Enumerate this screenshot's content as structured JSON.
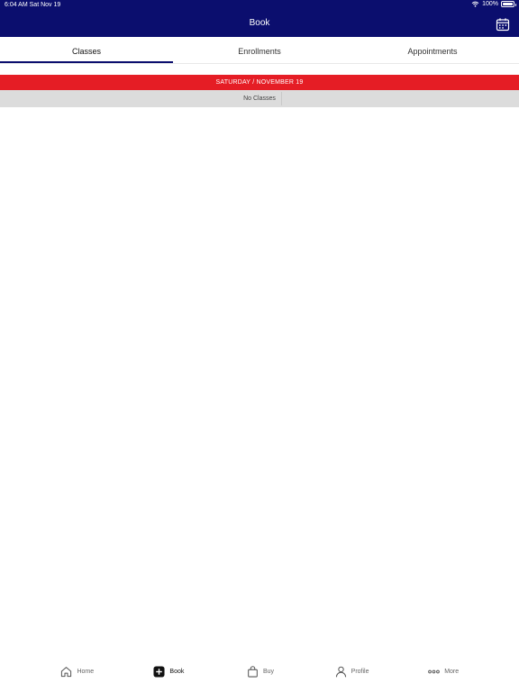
{
  "status_bar": {
    "time": "6:04 AM  Sat Nov 19",
    "battery": "100%",
    "battery_level": 1.0
  },
  "nav": {
    "title": "Book",
    "calendar_icon": "calendar-icon"
  },
  "tabs": [
    {
      "label": "Classes",
      "active": true
    },
    {
      "label": "Enrollments",
      "active": false
    },
    {
      "label": "Appointments",
      "active": false
    }
  ],
  "schedule": {
    "date_header": "SATURDAY / NOVEMBER 19",
    "empty_message": "No Classes"
  },
  "colors": {
    "nav_bg": "#0b0e6e",
    "date_banner": "#e51d25",
    "empty_row_bg": "#dcdcdc"
  },
  "tab_bar": {
    "items": [
      {
        "label": "Home",
        "icon": "home-icon"
      },
      {
        "label": "Book",
        "icon": "plus-square-icon",
        "active": true
      },
      {
        "label": "Buy",
        "icon": "shopping-bag-icon"
      },
      {
        "label": "Profile",
        "icon": "person-icon"
      },
      {
        "label": "More",
        "icon": "ellipsis-icon"
      }
    ]
  }
}
